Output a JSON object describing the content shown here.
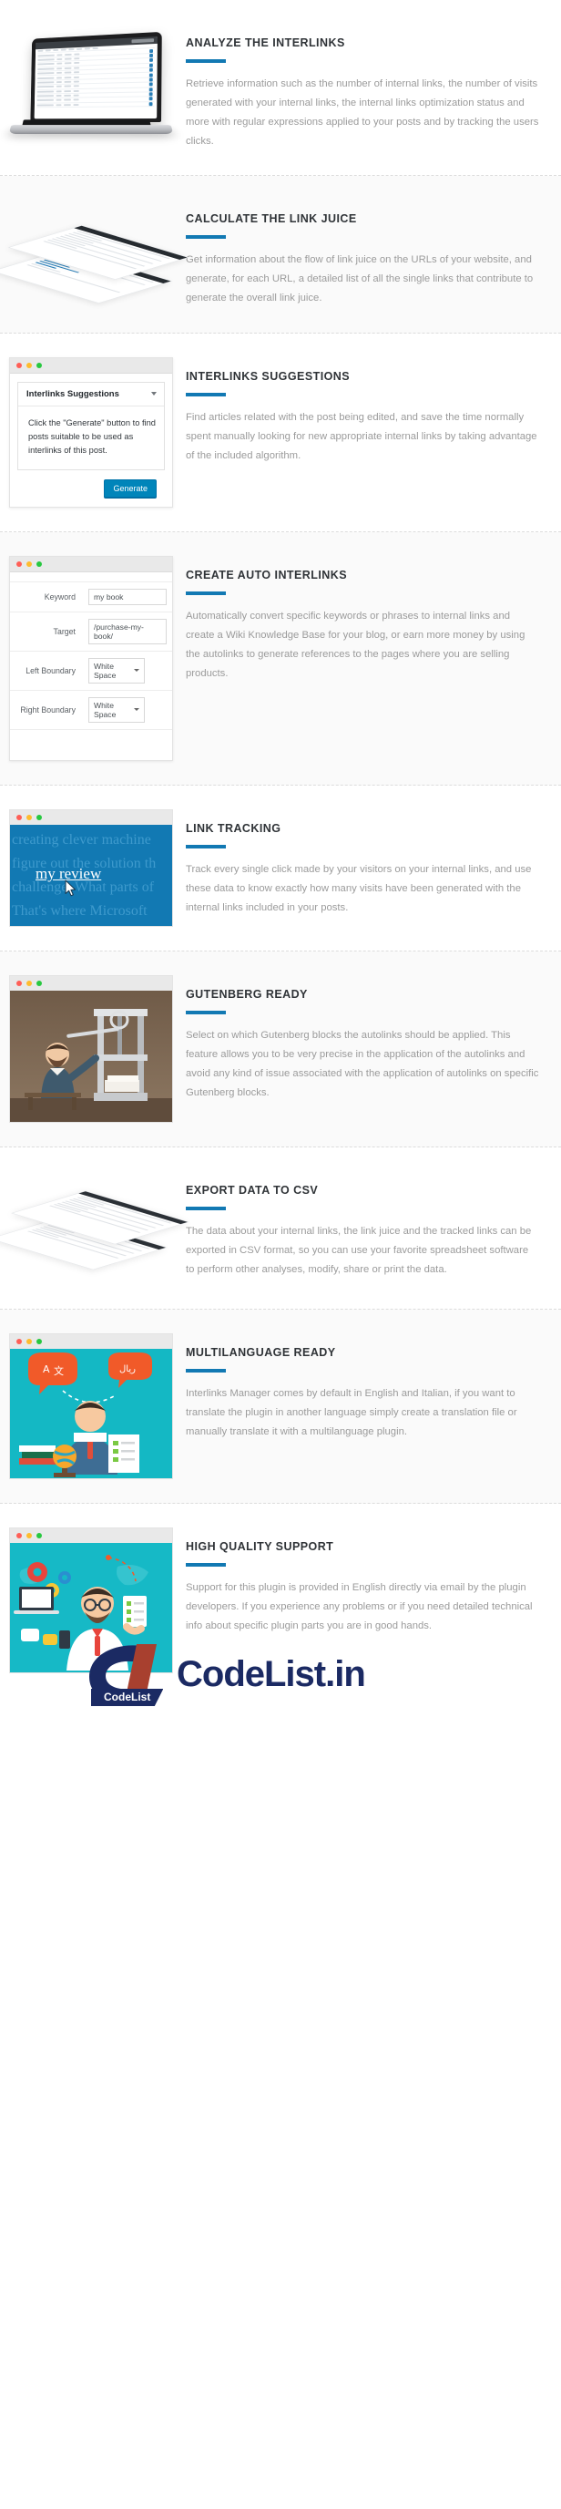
{
  "features": [
    {
      "id": "analyze-the-interlinks",
      "title": "ANALYZE THE INTERLINKS",
      "body": "Retrieve information such as the number of internal links, the number of visits generated with your internal links, the internal links optimization status and more with regular expressions applied to your posts and by tracking the users clicks."
    },
    {
      "id": "calculate-the-link-juice",
      "title": "CALCULATE THE LINK JUICE",
      "body": "Get information about the flow of link juice on the URLs of your website, and generate, for each URL, a detailed list of all the single links that contribute to generate the overall link juice."
    },
    {
      "id": "interlinks-suggestions",
      "title": "INTERLINKS SUGGESTIONS",
      "body": "Find articles related with the post being edited, and save the time normally spent manually looking for new appropriate internal links by taking advantage of the included algorithm."
    },
    {
      "id": "create-auto-interlinks",
      "title": "CREATE AUTO INTERLINKS",
      "body": "Automatically convert specific keywords or phrases to internal links and create a Wiki Knowledge Base for your blog, or earn more money by using the autolinks to generate references to the pages where you are selling products."
    },
    {
      "id": "link-tracking",
      "title": "LINK TRACKING",
      "body": "Track every single click made by your visitors on your internal links, and use these data to know exactly how many visits have been generated with the internal links included in your posts."
    },
    {
      "id": "gutenberg-ready",
      "title": "GUTENBERG READY",
      "body": "Select on which Gutenberg blocks the autolinks should be applied. This feature allows you to be very precise in the application of the autolinks and avoid any kind of issue associated with the application of autolinks on specific Gutenberg blocks."
    },
    {
      "id": "export-data-to-csv",
      "title": "EXPORT DATA TO CSV",
      "body": "The data about your internal links, the link juice and the tracked links can be exported in CSV format, so you can use your favorite spreadsheet software to perform other analyses, modify, share or print the data."
    },
    {
      "id": "multilanguage-ready",
      "title": "MULTILANGUAGE READY",
      "body": "Interlinks Manager comes by default in English and Italian, if you want to translate the plugin in another language simply create a translation file or manually translate it with a multilanguage plugin."
    },
    {
      "id": "high-quality-support",
      "title": "HIGH QUALITY SUPPORT",
      "body": "Support for this plugin is provided in English directly via email by the plugin developers. If you experience any problems or if you need detailed technical info about specific plugin parts you are in good hands."
    }
  ],
  "suggestions_panel": {
    "window_dots": [
      "close-dot",
      "minimize-dot",
      "maximize-dot"
    ],
    "card_title": "Interlinks Suggestions",
    "card_text": "Click the \"Generate\" button to find posts suitable to be used as interlinks of this post.",
    "button_label": "Generate"
  },
  "autolinks_panel": {
    "rows": [
      {
        "label": "Keyword",
        "value": "my book",
        "type": "text"
      },
      {
        "label": "Target",
        "value": "/purchase-my-book/",
        "type": "text"
      },
      {
        "label": "Left Boundary",
        "value": "White Space",
        "type": "select"
      },
      {
        "label": "Right Boundary",
        "value": "White Space",
        "type": "select"
      }
    ]
  },
  "link_tracking_media": {
    "background_text_lines": [
      "creating clever machine",
      "figure out the solution th",
      "challenge. What parts of",
      "That's where Microsoft"
    ],
    "link_text": "my review"
  },
  "footer": {
    "logo_mark_text": "CL",
    "logo_ribbon": "CodeList",
    "logo_word": "CodeList.in"
  },
  "colors": {
    "accent": "#1279b3",
    "heading": "#2f3337",
    "body_text": "#9b9b9b",
    "wp_button": "#0085ba",
    "teal": "#14b8c4"
  }
}
